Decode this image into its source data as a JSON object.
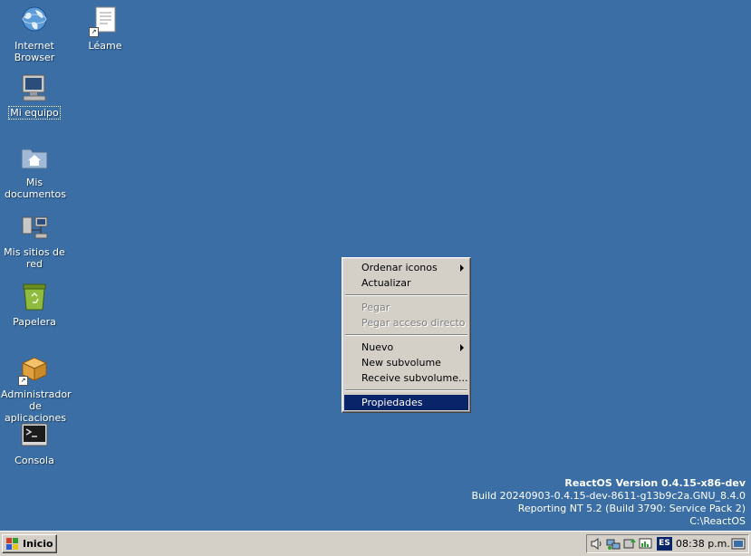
{
  "desktop": {
    "icons": [
      {
        "label": "Internet Browser",
        "icon": "globe-icon"
      },
      {
        "label": "Léame",
        "icon": "document-icon"
      },
      {
        "label": "Mi equipo",
        "icon": "computer-icon",
        "selected": true
      },
      {
        "label": "Mis documentos",
        "icon": "folder-icon"
      },
      {
        "label": "Mis sitios de red",
        "icon": "network-icon"
      },
      {
        "label": "Papelera",
        "icon": "recycle-bin-icon"
      },
      {
        "label": "Administrador de aplicaciones",
        "icon": "package-icon"
      },
      {
        "label": "Consola",
        "icon": "console-icon"
      }
    ]
  },
  "context_menu": {
    "items": [
      {
        "label": "Ordenar iconos",
        "submenu": true,
        "enabled": true
      },
      {
        "label": "Actualizar",
        "enabled": true
      },
      {
        "label": "Pegar",
        "enabled": false
      },
      {
        "label": "Pegar acceso directo",
        "enabled": false
      },
      {
        "label": "Nuevo",
        "submenu": true,
        "enabled": true
      },
      {
        "label": "New subvolume",
        "enabled": true
      },
      {
        "label": "Receive subvolume...",
        "enabled": true
      },
      {
        "label": "Propiedades",
        "enabled": true,
        "highlighted": true
      }
    ]
  },
  "version_info": {
    "line1": "ReactOS Version 0.4.15-x86-dev",
    "line2": "Build 20240903-0.4.15-dev-8611-g13b9c2a.GNU_8.4.0",
    "line3": "Reporting NT 5.2 (Build 3790: Service Pack 2)",
    "line4": "C:\\ReactOS"
  },
  "taskbar": {
    "start_label": "Inicio",
    "language": "ES",
    "clock": "08:38 p.m.",
    "tray_icons": [
      "volume-icon",
      "network-status-icon",
      "safely-remove-icon",
      "task-manager-icon"
    ]
  },
  "colors": {
    "desktop_bg": "#3a6ea5",
    "menu_bg": "#d4d0c8",
    "highlight": "#0a246a"
  }
}
